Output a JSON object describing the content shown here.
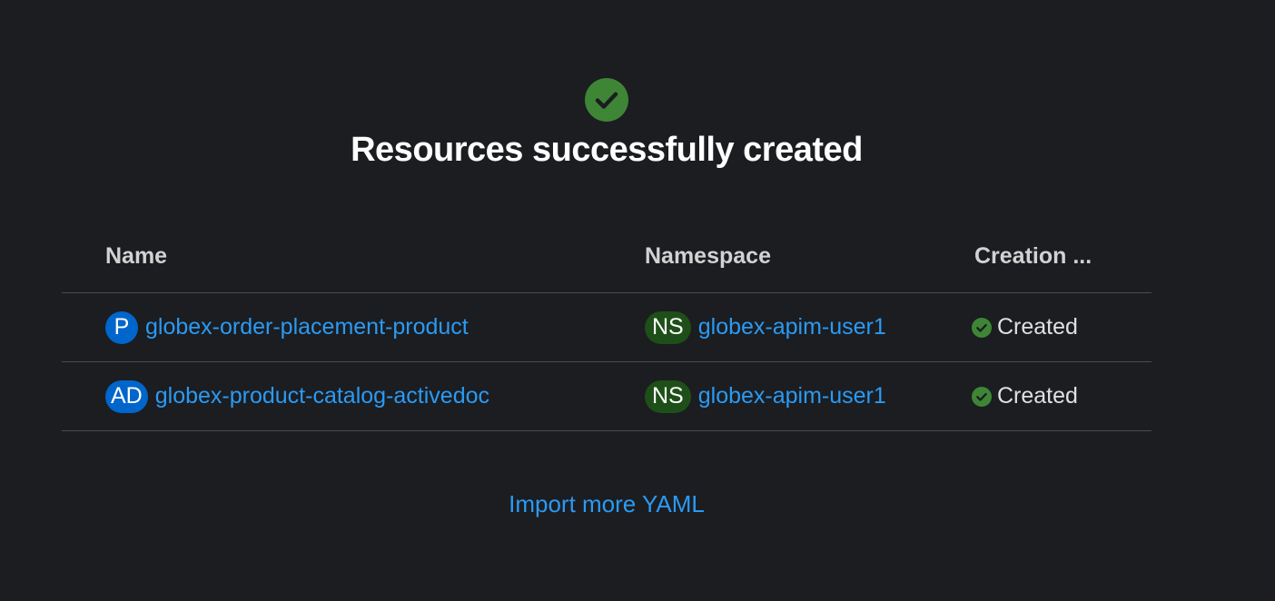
{
  "header": {
    "title": "Resources successfully created",
    "icon": "check-circle-icon",
    "icon_color": "#3e8635"
  },
  "table": {
    "columns": [
      "Name",
      "Namespace",
      "Creation ..."
    ],
    "rows": [
      {
        "kind_badge": "P",
        "name": "globex-order-placement-product",
        "namespace_badge": "NS",
        "namespace": "globex-apim-user1",
        "status": "Created"
      },
      {
        "kind_badge": "AD",
        "name": "globex-product-catalog-activedoc",
        "namespace_badge": "NS",
        "namespace": "globex-apim-user1",
        "status": "Created"
      }
    ]
  },
  "footer": {
    "import_more_label": "Import more YAML"
  },
  "colors": {
    "background": "#1b1d21",
    "link": "#2b9af3",
    "success": "#3e8635",
    "kind_badge": "#0066cc",
    "namespace_badge": "#1e4f18"
  }
}
